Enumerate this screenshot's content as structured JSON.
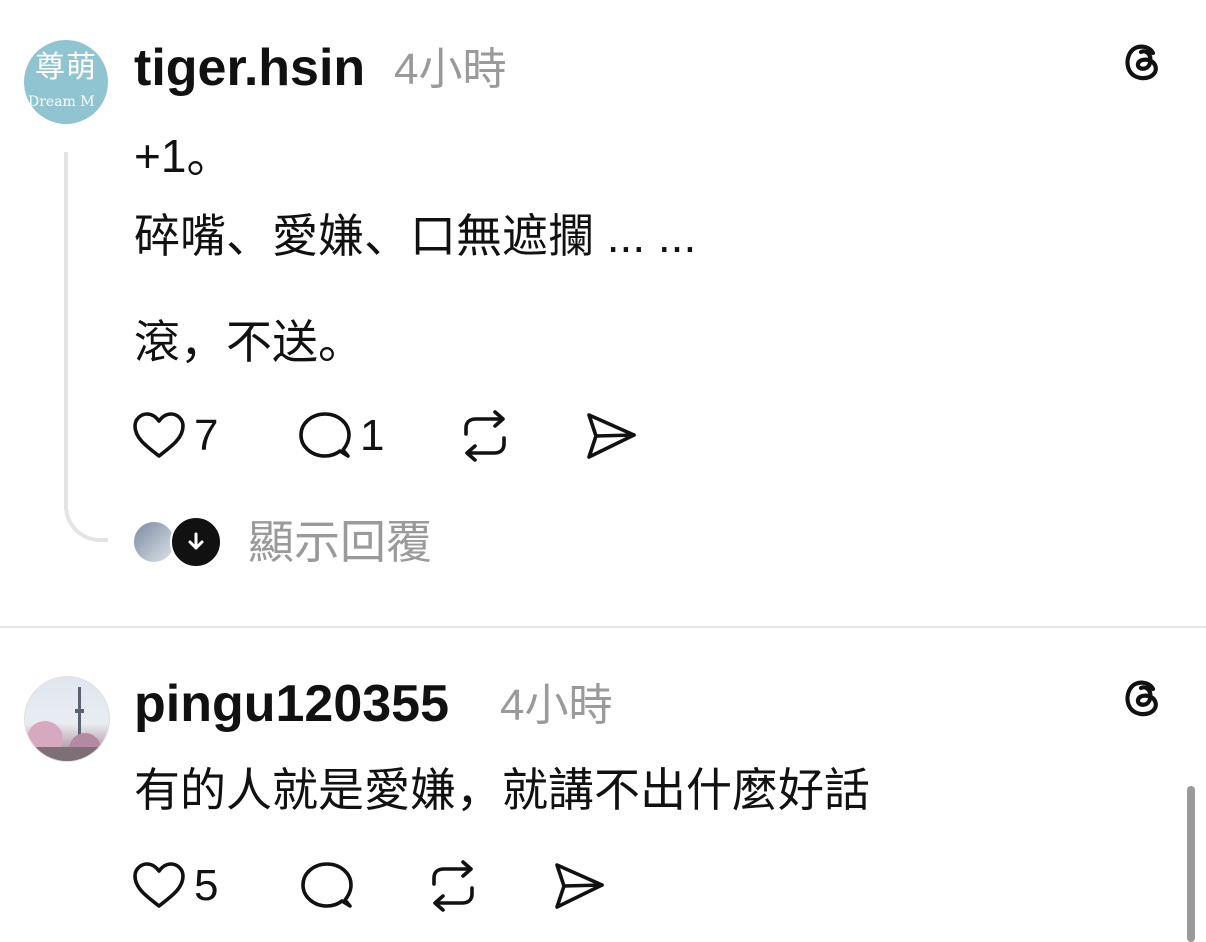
{
  "posts": [
    {
      "avatar_text": "尊萌",
      "avatar_subtext": "Dream M",
      "username": "tiger.hsin",
      "time": "4小時",
      "lines": [
        "+1。",
        "碎嘴、愛嫌、口無遮攔 ... ...",
        "滾，不送。"
      ],
      "likes": "7",
      "comments": "1",
      "show_replies": "顯示回覆"
    },
    {
      "username": "pingu120355",
      "time": "4小時",
      "lines": [
        "有的人就是愛嫌，就講不出什麼好話"
      ],
      "likes": "5"
    }
  ],
  "icons": [
    "threads-icon",
    "heart-icon",
    "comment-icon",
    "repost-icon",
    "share-icon",
    "arrow-down-icon"
  ],
  "colors": {
    "text": "#111111",
    "muted": "#9a9a9a",
    "divider": "#e6e6e6",
    "avatar_bg": "#8fc4d0"
  }
}
